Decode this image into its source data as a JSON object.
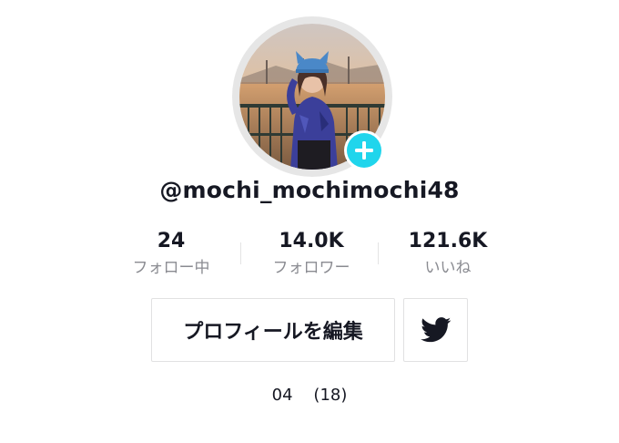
{
  "profile": {
    "username": "@mochi_mochimochi48",
    "bio": "04    (18)"
  },
  "stats": {
    "following": {
      "value": "24",
      "label": "フォロー中"
    },
    "followers": {
      "value": "14.0K",
      "label": "フォロワー"
    },
    "likes": {
      "value": "121.6K",
      "label": "いいね"
    }
  },
  "actions": {
    "edit_profile_label": "プロフィールを編集",
    "twitter_icon": "twitter-bird-icon",
    "add_icon": "plus-icon"
  },
  "colors": {
    "accent": "#20d5ec",
    "text_primary": "#161823",
    "text_secondary": "#8a8b91",
    "border": "#e1e1e2"
  }
}
